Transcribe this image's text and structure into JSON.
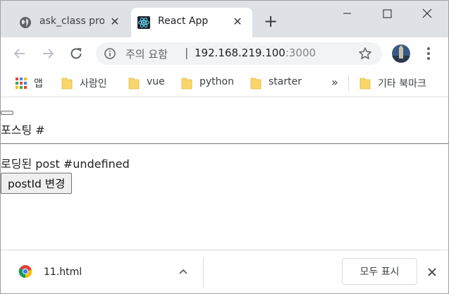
{
  "tabs": [
    {
      "label": "ask_class proj",
      "icon": "globe-icon",
      "active": false,
      "close": "✕"
    },
    {
      "label": "React App",
      "icon": "react-logo-icon",
      "active": true,
      "close": "✕"
    }
  ],
  "new_tab": "+",
  "toolbar": {
    "security_label": "주의 요함",
    "separator": "|",
    "url_host": "192.168.219.100",
    "url_port": ":3000"
  },
  "bookmarks": {
    "items": [
      {
        "label": "앱",
        "icon": "apps-grid-icon"
      },
      {
        "label": "사람인",
        "icon": "folder-icon"
      },
      {
        "label": "vue",
        "icon": "folder-icon"
      },
      {
        "label": "python",
        "icon": "folder-icon"
      },
      {
        "label": "starter",
        "icon": "folder-icon"
      }
    ],
    "overflow": "»",
    "other": "기타 북마크"
  },
  "page": {
    "post_title": "포스팅 #",
    "loaded_text": "로딩된 post #undefined",
    "change_button": "postId 변경"
  },
  "download_shelf": {
    "file_name": "11.html",
    "show_all": "모두 표시"
  },
  "colors": {
    "titlebar": "#dee1e6",
    "omnibox": "#f1f3f4",
    "folder": "#f9d66b",
    "react": "#61dafb"
  }
}
